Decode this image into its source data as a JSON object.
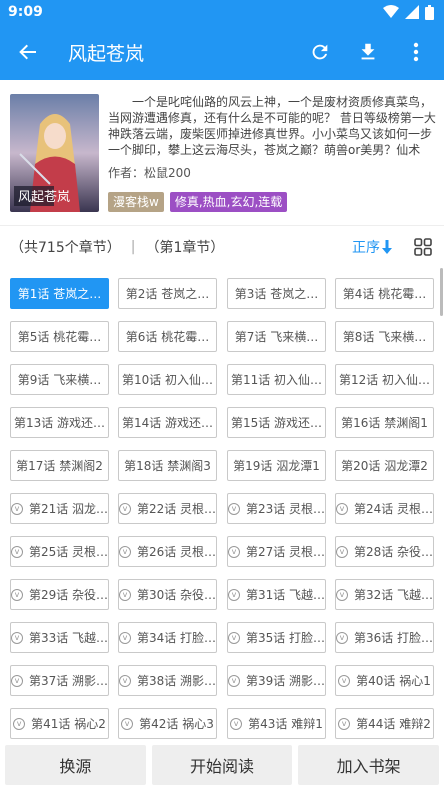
{
  "status": {
    "time": "9:09"
  },
  "toolbar": {
    "title": "风起苍岚"
  },
  "book": {
    "intro": "一个是叱咤仙路的风云上神，一个是废材资质修真菜鸟，当网游遭遇修真，还有什么是不可能的呢？ 昔日等级榜第一大神跌落云端，废柴医师掉进修真世界。小小菜鸟又该如何一步一个脚印，攀上这云海尽头，苍岚之巅？萌兽or美男？仙术or…",
    "author": "作者：松鼠200",
    "tags": [
      "漫客栈w",
      "修真,热血,玄幻,连载"
    ],
    "cover_text": "风起苍岚"
  },
  "chapter_bar": {
    "count": "（共715个章节）",
    "separator": "|",
    "current": "（第1章节）",
    "order": "正序"
  },
  "chapters": [
    {
      "label": "第1话 苍岚之…",
      "vip": false,
      "active": true
    },
    {
      "label": "第2话 苍岚之…",
      "vip": false
    },
    {
      "label": "第3话 苍岚之…",
      "vip": false
    },
    {
      "label": "第4话 桃花霉…",
      "vip": false
    },
    {
      "label": "第5话 桃花霉…",
      "vip": false
    },
    {
      "label": "第6话 桃花霉…",
      "vip": false
    },
    {
      "label": "第7话 飞来横…",
      "vip": false
    },
    {
      "label": "第8话 飞来横…",
      "vip": false
    },
    {
      "label": "第9话 飞来横…",
      "vip": false
    },
    {
      "label": "第10话 初入仙…",
      "vip": false
    },
    {
      "label": "第11话 初入仙…",
      "vip": false
    },
    {
      "label": "第12话 初入仙…",
      "vip": false
    },
    {
      "label": "第13话 游戏还…",
      "vip": false
    },
    {
      "label": "第14话 游戏还…",
      "vip": false
    },
    {
      "label": "第15话 游戏还…",
      "vip": false
    },
    {
      "label": "第16话 禁渊阁1",
      "vip": false
    },
    {
      "label": "第17话 禁渊阁2",
      "vip": false
    },
    {
      "label": "第18话 禁渊阁3",
      "vip": false
    },
    {
      "label": "第19话 泅龙潭1",
      "vip": false
    },
    {
      "label": "第20话 泅龙潭2",
      "vip": false
    },
    {
      "label": "第21话 泅龙…",
      "vip": true
    },
    {
      "label": "第22话 灵根…",
      "vip": true
    },
    {
      "label": "第23话 灵根…",
      "vip": true
    },
    {
      "label": "第24话 灵根…",
      "vip": true
    },
    {
      "label": "第25话 灵根…",
      "vip": true
    },
    {
      "label": "第26话 灵根…",
      "vip": true
    },
    {
      "label": "第27话 灵根…",
      "vip": true
    },
    {
      "label": "第28话 杂役…",
      "vip": true
    },
    {
      "label": "第29话 杂役…",
      "vip": true
    },
    {
      "label": "第30话 杂役…",
      "vip": true
    },
    {
      "label": "第31话 飞越…",
      "vip": true
    },
    {
      "label": "第32话 飞越…",
      "vip": true
    },
    {
      "label": "第33话 飞越…",
      "vip": true
    },
    {
      "label": "第34话 打脸…",
      "vip": true
    },
    {
      "label": "第35话 打脸…",
      "vip": true
    },
    {
      "label": "第36话 打脸…",
      "vip": true
    },
    {
      "label": "第37话 溯影…",
      "vip": true
    },
    {
      "label": "第38话 溯影…",
      "vip": true
    },
    {
      "label": "第39话 溯影…",
      "vip": true
    },
    {
      "label": "第40话 祸心1",
      "vip": true
    },
    {
      "label": "第41话 祸心2",
      "vip": true
    },
    {
      "label": "第42话 祸心3",
      "vip": true
    },
    {
      "label": "第43话 难辩1",
      "vip": true
    },
    {
      "label": "第44话 难辩2",
      "vip": true
    }
  ],
  "vip_mark": "v",
  "bottom": {
    "change_source": "换源",
    "start_reading": "开始阅读",
    "add_shelf": "加入书架"
  },
  "colors": {
    "primary": "#2196f3",
    "tag1": "#b5a386",
    "tag2": "#9c4fc4"
  },
  "icons": [
    "back-icon",
    "refresh-icon",
    "download-icon",
    "more-icon",
    "sort-arrow-icon",
    "grid-view-icon",
    "wifi-icon",
    "signal-icon",
    "battery-icon"
  ]
}
